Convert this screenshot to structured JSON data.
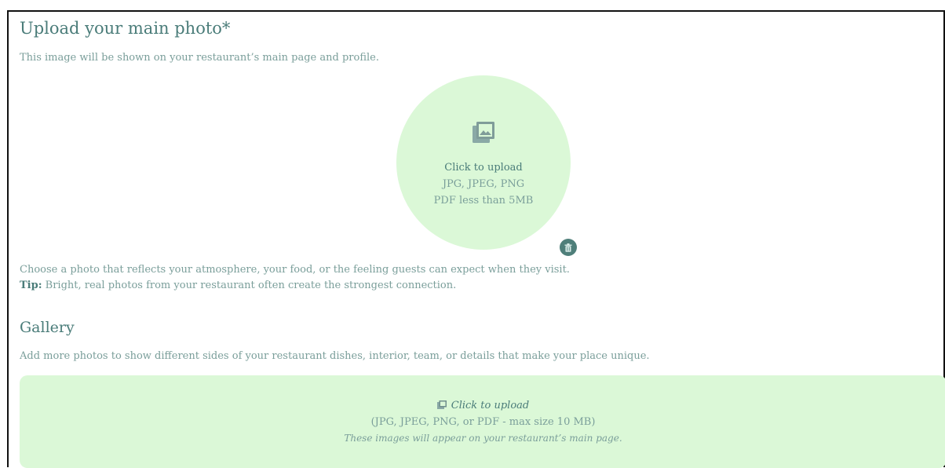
{
  "main_photo": {
    "title": "Upload your main photo*",
    "subtitle": "This image will be shown on your restaurant’s main page and profile.",
    "upload": {
      "icon": "image-gallery-icon",
      "label": "Click to upload",
      "formats": "JPG, JPEG, PNG",
      "size": "PDF less than 5MB"
    },
    "delete_icon": "trash-icon",
    "hint": "Choose a photo that reflects your atmosphere, your food, or the feeling guests can expect when they visit.",
    "tip_label": "Tip:",
    "tip_text": " Bright, real photos from your restaurant often create the strongest connection."
  },
  "gallery": {
    "title": "Gallery",
    "description": "Add more photos to show different sides of your restaurant dishes, interior, team, or details that make your place unique.",
    "upload": {
      "icon": "image-gallery-icon",
      "label": "Click to upload",
      "formats": "(JPG, JPEG, PNG, or PDF - max size 10 MB)",
      "note": "These images will appear on your restaurant’s main page."
    }
  },
  "colors": {
    "accent": "#4f7f7a",
    "upload_bg": "#dbf8d7",
    "muted_text": "#7a9e9a"
  }
}
